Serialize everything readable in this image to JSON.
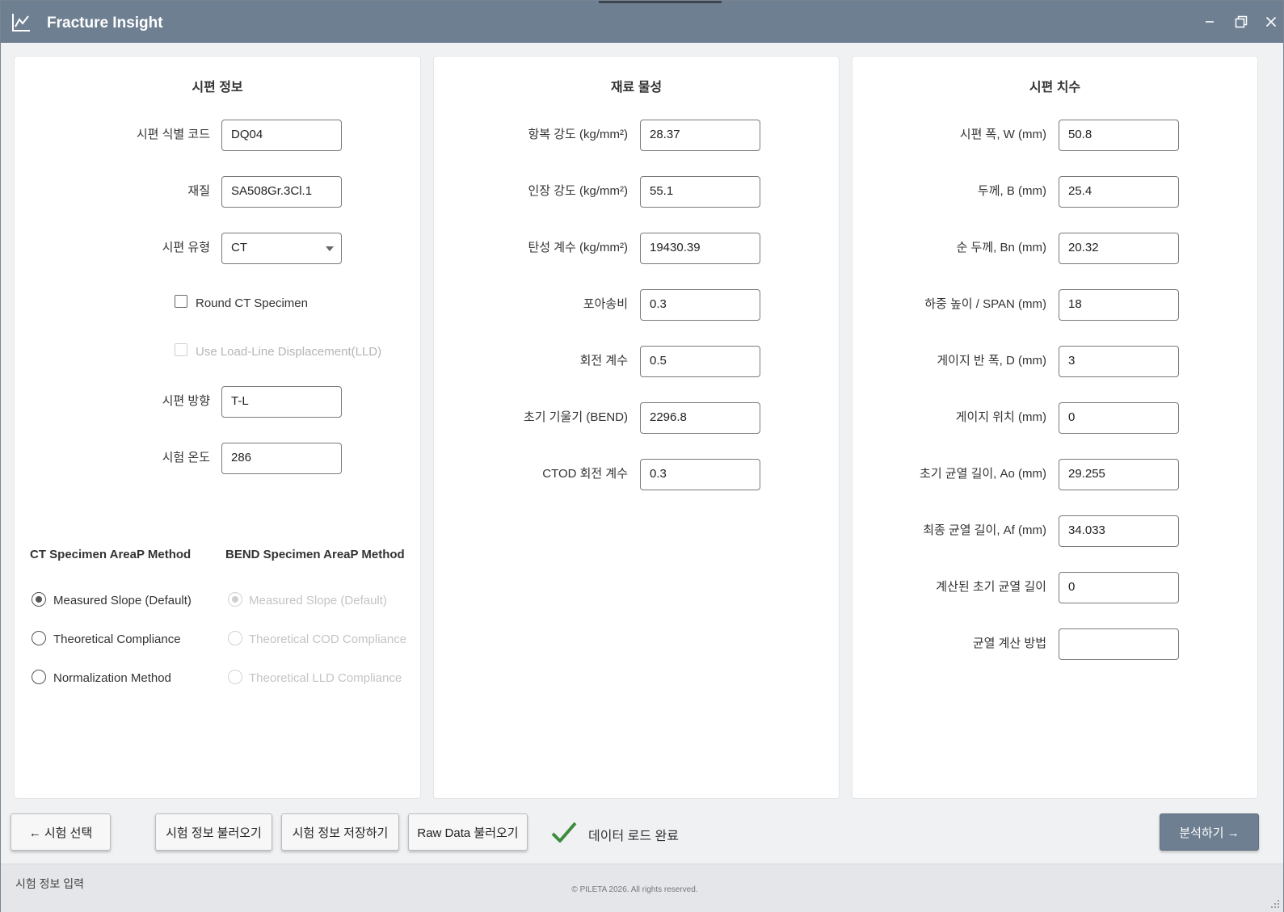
{
  "window": {
    "title": "Fracture Insight",
    "accent": "#6e7f91"
  },
  "specimen_info": {
    "title": "시편 정보",
    "fields": [
      {
        "label": "시편 식별 코드",
        "value": "DQ04"
      },
      {
        "label": "재질",
        "value": "SA508Gr.3Cl.1"
      },
      {
        "label": "시편 유형",
        "value": "CT"
      },
      {
        "label": "시편 방향",
        "value": "T-L"
      },
      {
        "label": "시험 온도",
        "value": "286"
      }
    ],
    "round_ct_label": "Round CT Specimen",
    "round_ct_checked": false,
    "lld_label": "Use Load-Line Displacement(LLD)",
    "lld_checked": false,
    "lld_enabled": false,
    "ct_method": {
      "title": "CT Specimen AreaP Method",
      "options": [
        "Measured Slope (Default)",
        "Theoretical Compliance",
        "Normalization Method"
      ],
      "selected": "Measured Slope (Default)"
    },
    "bend_method": {
      "title": "BEND Specimen AreaP Method",
      "options": [
        "Measured Slope (Default)",
        "Theoretical COD Compliance",
        "Theoretical LLD Compliance"
      ],
      "selected": "Measured Slope (Default)",
      "enabled": false
    }
  },
  "material": {
    "title": "재료 물성",
    "fields": [
      {
        "label": "항복 강도 (kg/mm²)",
        "value": "28.37"
      },
      {
        "label": "인장 강도 (kg/mm²)",
        "value": "55.1"
      },
      {
        "label": "탄성 계수 (kg/mm²)",
        "value": "19430.39"
      },
      {
        "label": "포아송비",
        "value": "0.3"
      },
      {
        "label": "회전 계수",
        "value": "0.5"
      },
      {
        "label": "초기 기울기 (BEND)",
        "value": "2296.8"
      },
      {
        "label": "CTOD 회전 계수",
        "value": "0.3"
      }
    ]
  },
  "dimensions": {
    "title": "시편 치수",
    "fields": [
      {
        "label": "시편 폭, W (mm)",
        "value": "50.8"
      },
      {
        "label": "두께, B (mm)",
        "value": "25.4"
      },
      {
        "label": "순 두께, Bn (mm)",
        "value": "20.32"
      },
      {
        "label": "하중 높이 / SPAN (mm)",
        "value": "18"
      },
      {
        "label": "게이지 반 폭, D (mm)",
        "value": "3"
      },
      {
        "label": "게이지 위치 (mm)",
        "value": "0"
      },
      {
        "label": "초기 균열 길이, Ao (mm)",
        "value": "29.255"
      },
      {
        "label": "최종 균열 길이, Af (mm)",
        "value": "34.033"
      },
      {
        "label": "계산된 초기 균열 길이",
        "value": "0"
      },
      {
        "label": "균열 계산 방법",
        "value": ""
      }
    ]
  },
  "toolbar": {
    "back_label": "← 시험 선택",
    "load_info_label": "시험 정보 불러오기",
    "save_info_label": "시험 정보 저장하기",
    "load_raw_label": "Raw Data 불러오기",
    "status_text": "데이터 로드 완료",
    "analyze_label": "분석하기 →"
  },
  "statusbar": {
    "left_text": "시험 정보 입력",
    "copyright": "© PILETA 2026. All rights reserved."
  }
}
